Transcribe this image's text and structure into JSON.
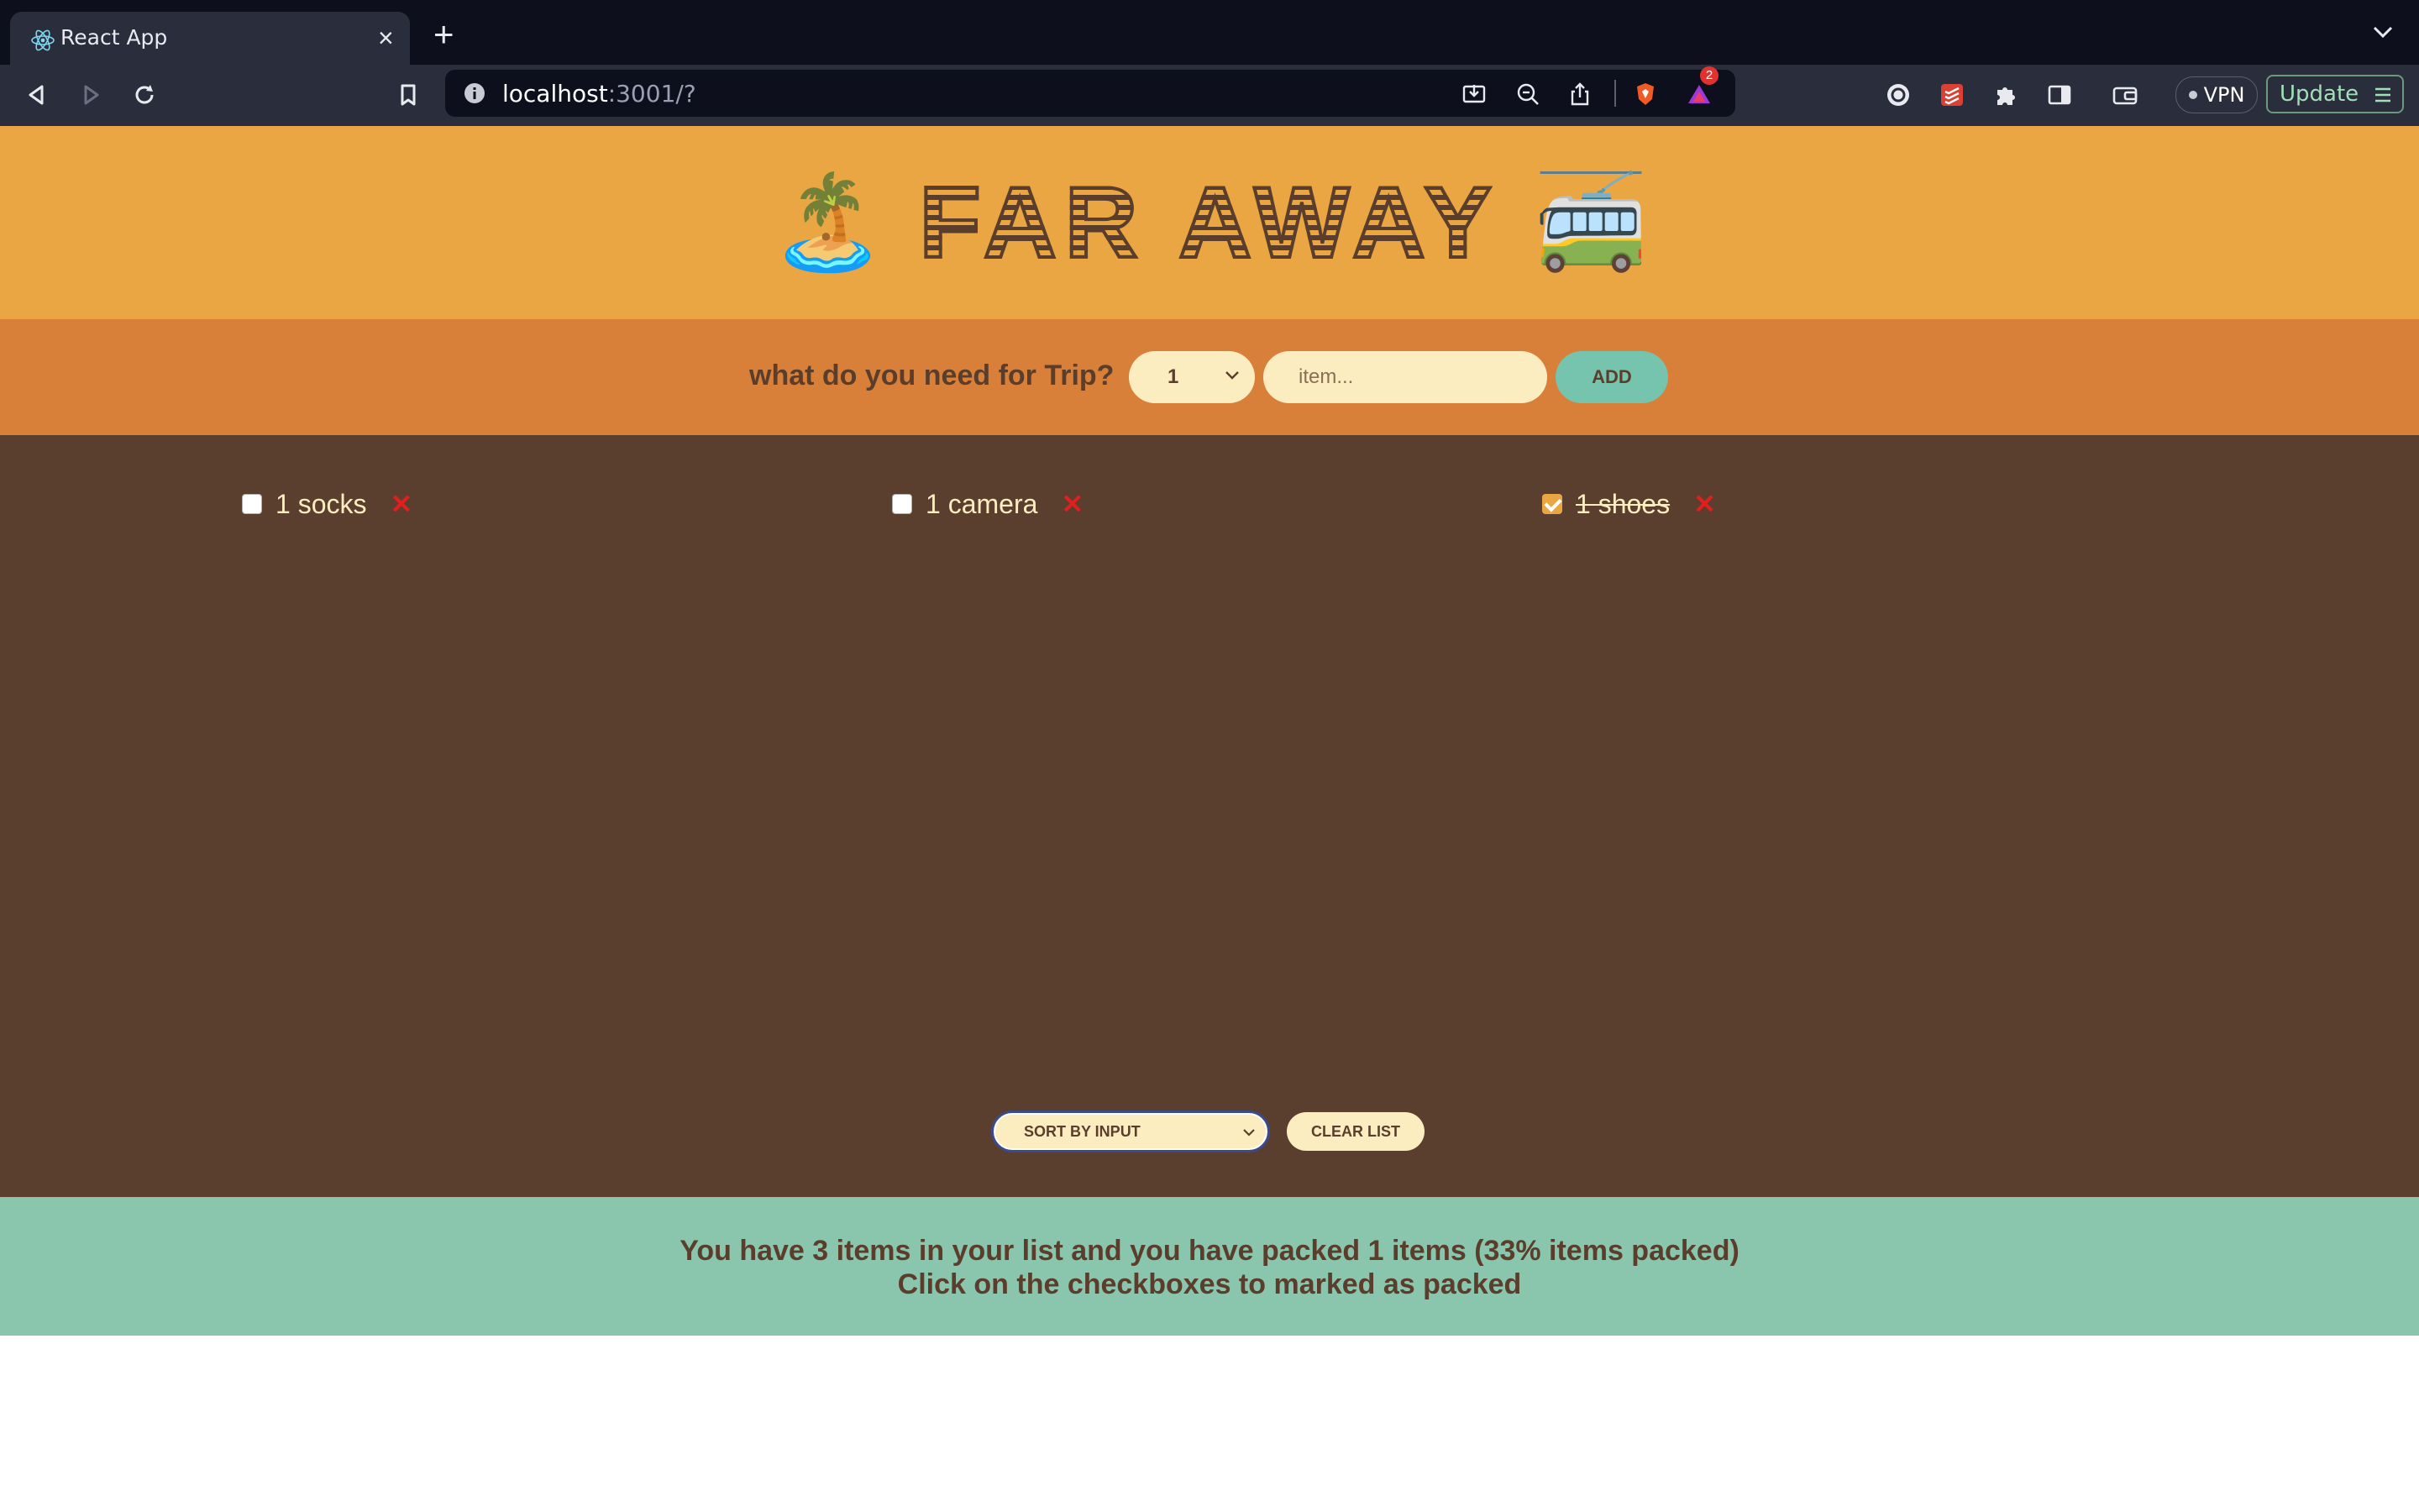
{
  "browser": {
    "tab_title": "React App",
    "url_host": "localhost",
    "url_rest": ":3001/?",
    "vpn_label": "VPN",
    "update_label": "Update",
    "notification_count": "2"
  },
  "app": {
    "title": "FAR AWAY",
    "title_left_emoji": "🏝️",
    "title_right_emoji": "🚎",
    "form": {
      "prompt": "what do you need for Trip?",
      "quantity_value": "1",
      "item_placeholder": "item...",
      "add_label": "ADD"
    },
    "items": [
      {
        "label": "1 socks",
        "packed": false
      },
      {
        "label": "1 camera",
        "packed": false
      },
      {
        "label": "1 shoes",
        "packed": true
      }
    ],
    "delete_glyph": "✕",
    "actions": {
      "sort_value": "SORT BY INPUT",
      "clear_label": "CLEAR LIST"
    },
    "stats": {
      "line1": "You have 3 items in your list and you have packed 1 items (33% items packed)",
      "line2": "Click on the checkboxes to marked as packed"
    }
  },
  "colors": {
    "header_bg": "#e9a642",
    "form_bg": "#d8803a",
    "list_bg": "#5a3f2f",
    "stats_bg": "#8ac5ad",
    "text_brown": "#5a3e2b",
    "cream": "#fcedc0",
    "delete_red": "#e01f1f"
  }
}
